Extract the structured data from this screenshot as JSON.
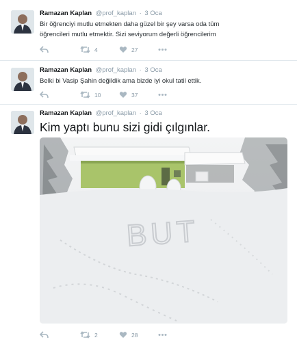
{
  "tweets": [
    {
      "name": "Ramazan Kaplan",
      "handle": "@prof_kaplan",
      "separator": "·",
      "time": "3 Oca",
      "text_line1": "Bir öğrenciyi mutlu etmekten daha güzel bir şey varsa oda tüm",
      "text_line2": "öğrencileri mutlu etmektir. Sizi seviyorum değerli öğrencilerim",
      "retweets": "4",
      "likes": "27"
    },
    {
      "name": "Ramazan Kaplan",
      "handle": "@prof_kaplan",
      "separator": "·",
      "time": "3 Oca",
      "text_line1": "Belki bi Vasip Şahin değildik ama bizde iyi okul tatil ettik.",
      "retweets": "10",
      "likes": "37"
    },
    {
      "name": "Ramazan Kaplan",
      "handle": "@prof_kaplan",
      "separator": "·",
      "time": "3 Oca",
      "text_line1": "Kim yaptı bunu sizi gidi çılgınlar.",
      "snow_writing": "BUT",
      "retweets": "2",
      "likes": "28"
    }
  ],
  "colors": {
    "action_icon": "#aab8c2",
    "secondary_text": "#8899a6",
    "divider": "#e1e8ed",
    "building_wall": "#a9c46a"
  },
  "icons": [
    "avatar",
    "reply-icon",
    "retweet-icon",
    "like-icon",
    "more-icon"
  ]
}
